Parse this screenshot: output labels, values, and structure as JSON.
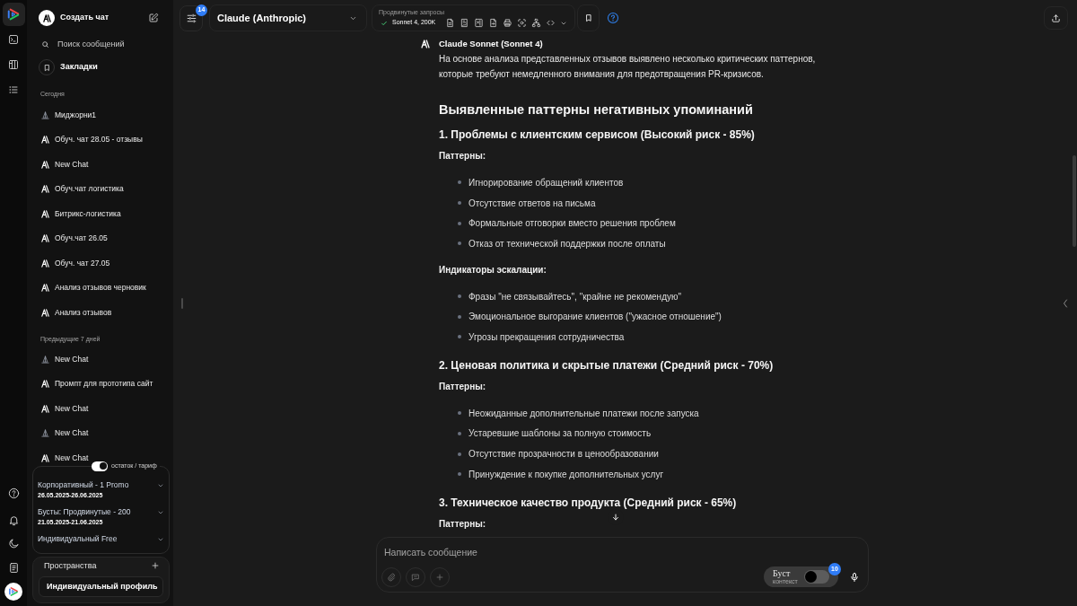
{
  "sidebar": {
    "new_chat": "Создать чат",
    "search": {
      "placeholder": "Поиск сообщений"
    },
    "bookmarks": "Закладки",
    "groups": [
      {
        "title": "Сегодня",
        "chats": [
          {
            "title": "Миджорни1",
            "kind": "image",
            "selected": false
          },
          {
            "title": "Обуч. чат 28.05 - отзывы",
            "kind": "text",
            "selected": false
          },
          {
            "title": "New Chat",
            "kind": "text",
            "selected": false
          },
          {
            "title": "Обуч.чат логистика",
            "kind": "text",
            "selected": false
          },
          {
            "title": "Битрикс-логистика",
            "kind": "text",
            "selected": false
          },
          {
            "title": "Обуч.чат 26.05",
            "kind": "text",
            "selected": false
          },
          {
            "title": "Обуч. чат 27.05",
            "kind": "text",
            "selected": false
          },
          {
            "title": "Анализ отзывов черновик",
            "kind": "text",
            "selected": false
          },
          {
            "title": "Анализ отзывов",
            "kind": "text",
            "selected": false
          }
        ]
      },
      {
        "title": "Предыдущие 7 дней",
        "chats": [
          {
            "title": "New Chat",
            "kind": "image",
            "selected": false
          },
          {
            "title": "Промпт для прототипа сайт",
            "kind": "text",
            "selected": false
          },
          {
            "title": "New Chat",
            "kind": "text",
            "selected": false
          },
          {
            "title": "New Chat",
            "kind": "image",
            "selected": false
          },
          {
            "title": "New Chat",
            "kind": "text",
            "selected": false
          }
        ]
      }
    ]
  },
  "plans": {
    "toggle": {
      "label": "остаток / тариф",
      "on": true
    },
    "items": [
      {
        "name": "Корпоративный - 1 Promo",
        "period": "26.05.2025-26.06.2025",
        "expanded": false
      },
      {
        "name": "Бусты: Продвинутые - 200",
        "period": "21.05.2025-21.06.2025",
        "expanded": false
      },
      {
        "name": "Индивидуальный Free",
        "expanded": false
      }
    ]
  },
  "spaces": {
    "title": "Пространства",
    "profile": "Индивидуальный профиль"
  },
  "toolbar": {
    "settings_badge": "14",
    "model": "Claude (Anthropic)",
    "requests": {
      "label": "Продвинутые запросы",
      "model": "Sonnet 4, 200K"
    }
  },
  "message": {
    "author": "Claude Sonnet (Sonnet 4)",
    "blocks": [
      {
        "kind": "paragraph",
        "text": "На основе анализа представленных отзывов выявлено несколько критических паттернов, которые требуют немедленного внимания для предотвращения PR-кризисов."
      },
      {
        "kind": "heading",
        "text": "Выявленные паттерны негативных упоминаний"
      },
      {
        "kind": "subheading",
        "text": "1. Проблемы с клиентским сервисом (Высокий риск - 85%)"
      },
      {
        "kind": "label",
        "text": "Паттерны:"
      },
      {
        "kind": "list",
        "items": [
          "Игнорирование обращений клиентов",
          "Отсутствие ответов на письма",
          "Формальные отговорки вместо решения проблем",
          "Отказ от технической поддержки после оплаты"
        ]
      },
      {
        "kind": "label",
        "text": "Индикаторы эскалации:"
      },
      {
        "kind": "list",
        "items": [
          "Фразы \"не связывайтесь\", \"крайне не рекомендую\"",
          "Эмоциональное выгорание клиентов (\"ужасное отношение\")",
          "Угрозы прекращения сотрудничества"
        ]
      },
      {
        "kind": "subheading",
        "text": "2. Ценовая политика и скрытые платежи (Средний риск - 70%)"
      },
      {
        "kind": "label",
        "text": "Паттерны:"
      },
      {
        "kind": "list",
        "items": [
          "Неожиданные дополнительные платежи после запуска",
          "Устаревшие шаблоны за полную стоимость",
          "Отсутствие прозрачности в ценообразовании",
          "Принуждение к покупке дополнительных услуг"
        ]
      },
      {
        "kind": "subheading",
        "text": "3. Техническое качество продукта (Средний риск - 65%)"
      },
      {
        "kind": "label",
        "text": "Паттерны:"
      }
    ]
  },
  "composer": {
    "placeholder": "Написать сообщение",
    "boost": {
      "label": "Буст",
      "sublabel": "контекст",
      "on": false,
      "badge": "10"
    }
  }
}
